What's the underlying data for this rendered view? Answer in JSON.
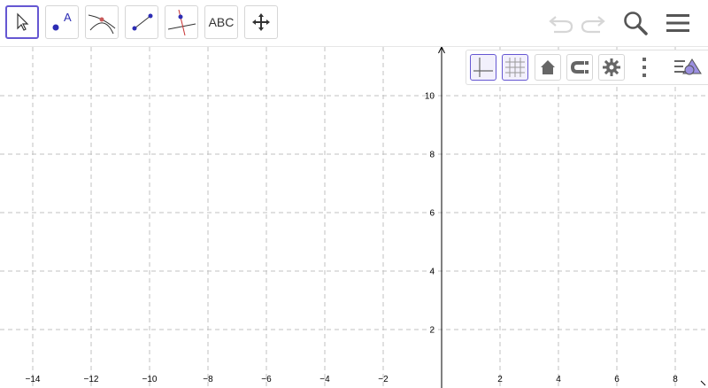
{
  "toolbar": {
    "tools": [
      {
        "name": "move-tool",
        "icon": "arrow-cursor-icon",
        "selected": true
      },
      {
        "name": "point-tool",
        "icon": "point-icon",
        "label": "A"
      },
      {
        "name": "intersect-tool",
        "icon": "intersect-icon"
      },
      {
        "name": "segment-tool",
        "icon": "segment-icon"
      },
      {
        "name": "perpendicular-tool",
        "icon": "perpendicular-line-icon"
      },
      {
        "name": "text-tool",
        "icon": "text-icon",
        "label": "ABC"
      },
      {
        "name": "move-graphics-tool",
        "icon": "move-arrows-icon"
      }
    ],
    "right": [
      "undo-icon",
      "redo-icon",
      "search-icon",
      "menu-icon"
    ]
  },
  "style_bar": [
    "axes-icon",
    "grid-icon",
    "home-icon",
    "magnet-icon",
    "gear-icon",
    "more-vertical-icon",
    "style-panel-icon"
  ],
  "graph": {
    "x_ticks": [
      -14,
      -12,
      -10,
      -8,
      -6,
      -4,
      -2,
      2,
      4,
      6,
      8
    ],
    "y_ticks": [
      2,
      4,
      6,
      8,
      10
    ],
    "x_tick_labels": [
      "−14",
      "−12",
      "−10",
      "−8",
      "−6",
      "−4",
      "−2",
      "2",
      "4",
      "6",
      "8"
    ],
    "y_tick_labels": [
      "2",
      "4",
      "6",
      "8",
      "10"
    ],
    "grid": true,
    "colors": {
      "grid": "#c0c0c0",
      "axis": "#000000",
      "accent": "#6557d2"
    }
  }
}
